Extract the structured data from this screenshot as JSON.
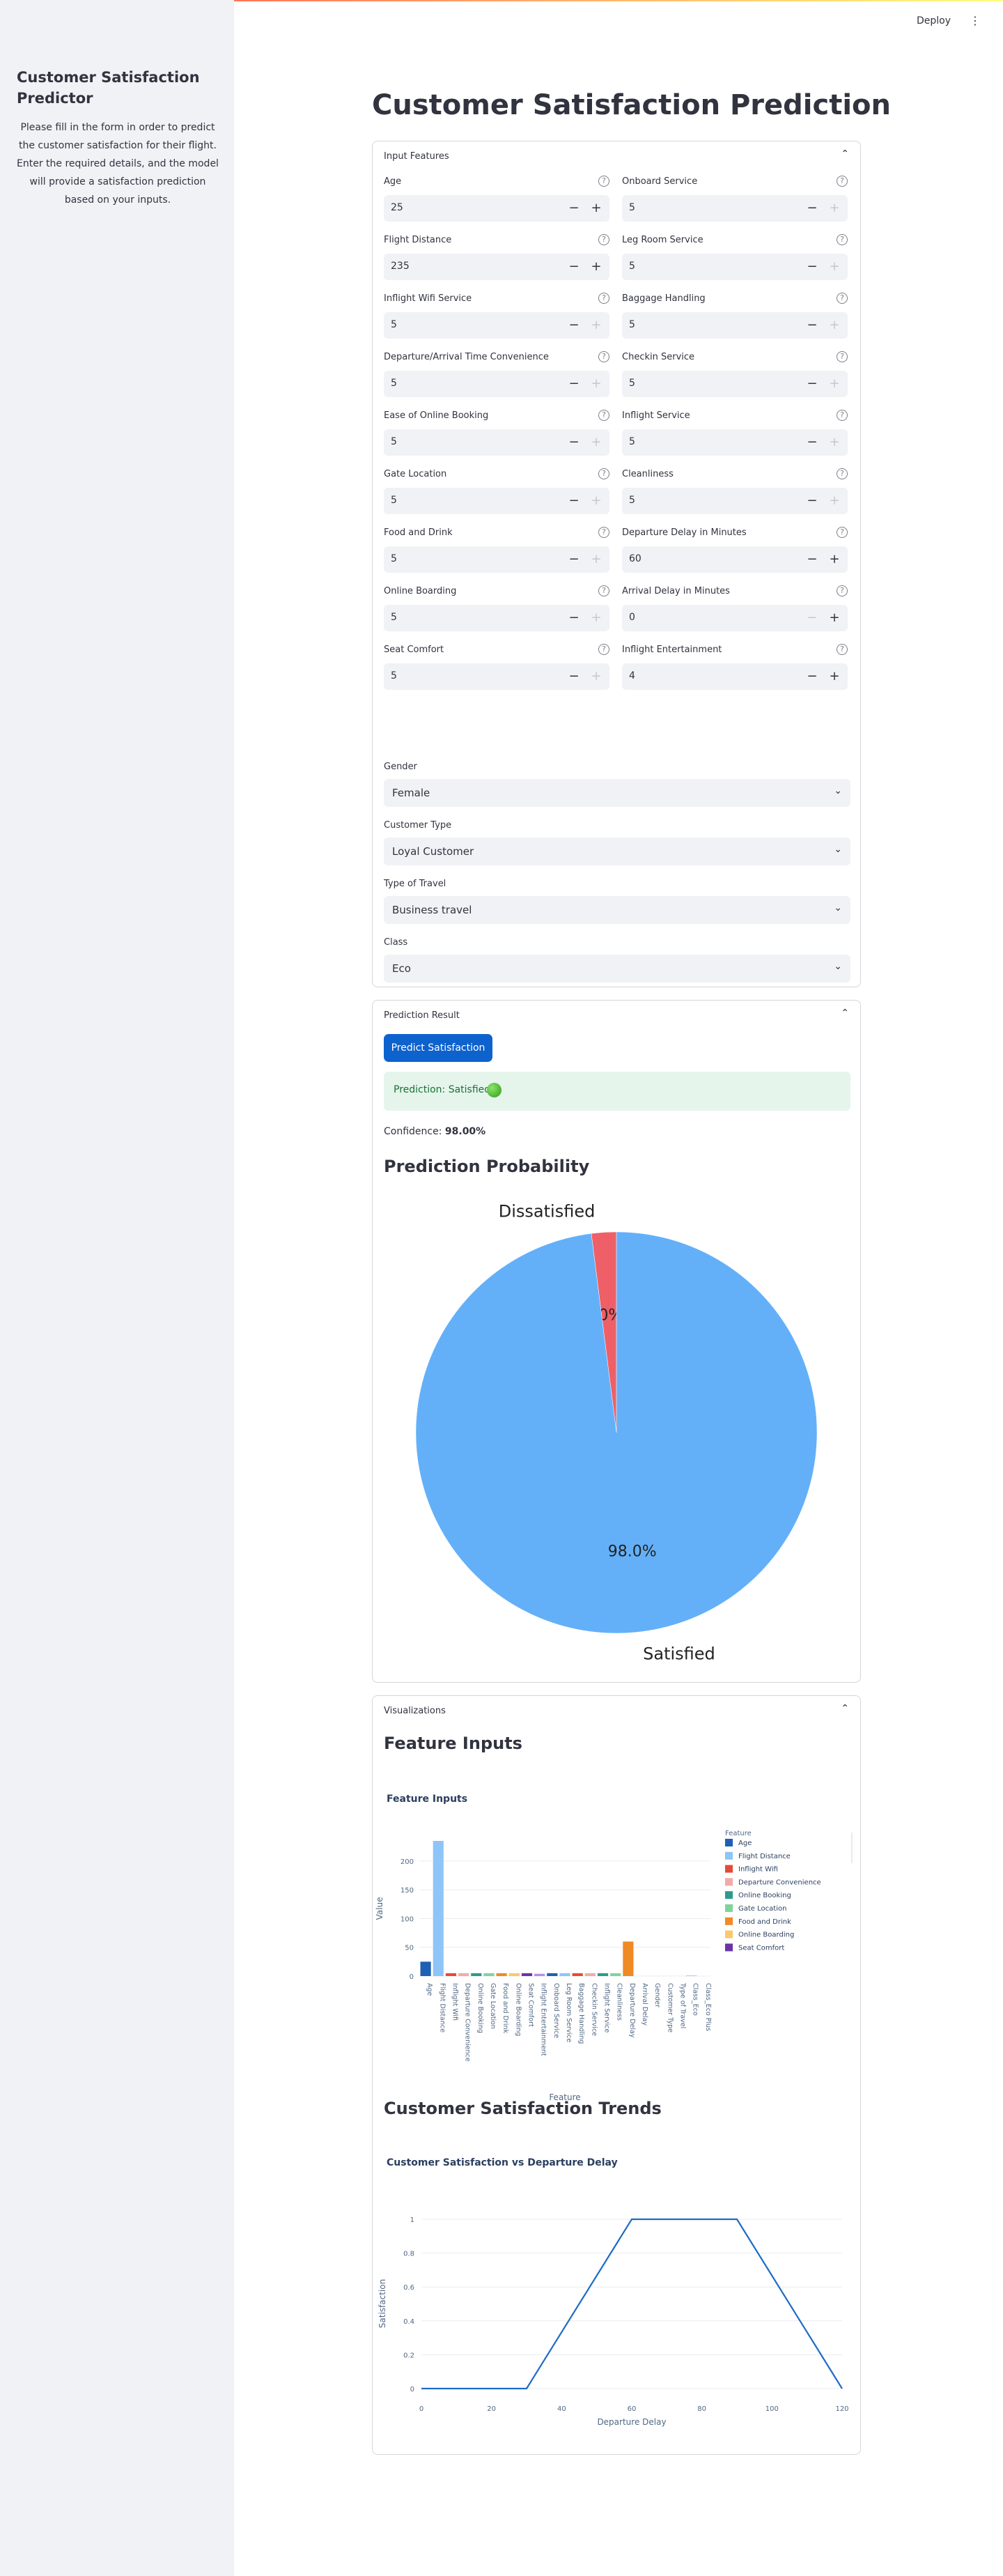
{
  "app": {
    "deploy_label": "Deploy",
    "menu_glyph": "⋮"
  },
  "sidebar": {
    "title": "Customer Satisfaction Predictor",
    "description": "Please fill in the form in order to predict the customer satisfaction for their flight. Enter the required details, and the model will provide a satisfaction prediction based on your inputs."
  },
  "page_title": "Customer Satisfaction Prediction",
  "input_features": {
    "header": "Input Features",
    "fields": [
      {
        "label": "Age",
        "value": "25",
        "minus_disabled": false,
        "plus_disabled": false
      },
      {
        "label": "Onboard Service",
        "value": "5",
        "minus_disabled": false,
        "plus_disabled": true
      },
      {
        "label": "Flight Distance",
        "value": "235",
        "minus_disabled": false,
        "plus_disabled": false
      },
      {
        "label": "Leg Room Service",
        "value": "5",
        "minus_disabled": false,
        "plus_disabled": true
      },
      {
        "label": "Inflight Wifi Service",
        "value": "5",
        "minus_disabled": false,
        "plus_disabled": true
      },
      {
        "label": "Baggage Handling",
        "value": "5",
        "minus_disabled": false,
        "plus_disabled": true
      },
      {
        "label": "Departure/Arrival Time Convenience",
        "value": "5",
        "minus_disabled": false,
        "plus_disabled": true
      },
      {
        "label": "Checkin Service",
        "value": "5",
        "minus_disabled": false,
        "plus_disabled": true
      },
      {
        "label": "Ease of Online Booking",
        "value": "5",
        "minus_disabled": false,
        "plus_disabled": true
      },
      {
        "label": "Inflight Service",
        "value": "5",
        "minus_disabled": false,
        "plus_disabled": true
      },
      {
        "label": "Gate Location",
        "value": "5",
        "minus_disabled": false,
        "plus_disabled": true
      },
      {
        "label": "Cleanliness",
        "value": "5",
        "minus_disabled": false,
        "plus_disabled": true
      },
      {
        "label": "Food and Drink",
        "value": "5",
        "minus_disabled": false,
        "plus_disabled": true
      },
      {
        "label": "Departure Delay in Minutes",
        "value": "60",
        "minus_disabled": false,
        "plus_disabled": false
      },
      {
        "label": "Online Boarding",
        "value": "5",
        "minus_disabled": false,
        "plus_disabled": true
      },
      {
        "label": "Arrival Delay in Minutes",
        "value": "0",
        "minus_disabled": true,
        "plus_disabled": false
      },
      {
        "label": "Seat Comfort",
        "value": "5",
        "minus_disabled": false,
        "plus_disabled": true
      },
      {
        "label": "Inflight Entertainment",
        "value": "4",
        "minus_disabled": false,
        "plus_disabled": false
      }
    ],
    "selects": [
      {
        "label": "Gender",
        "value": "Female"
      },
      {
        "label": "Customer Type",
        "value": "Loyal Customer"
      },
      {
        "label": "Type of Travel",
        "value": "Business travel"
      },
      {
        "label": "Class",
        "value": "Eco"
      }
    ],
    "help_glyph": "?",
    "minus_glyph": "−",
    "plus_glyph": "+",
    "chevron_up": "⌃",
    "chevron_down": "⌄"
  },
  "prediction": {
    "header": "Prediction Result",
    "button_label": "Predict Satisfaction",
    "result_text": "Prediction: Satisfied",
    "confidence_label": "Confidence: ",
    "confidence_value": "98.00%",
    "probability_title": "Prediction Probability"
  },
  "visualizations": {
    "header": "Visualizations",
    "feature_inputs_heading": "Feature Inputs",
    "trends_heading": "Customer Satisfaction Trends"
  },
  "chart_data": [
    {
      "type": "pie",
      "title": "",
      "labels": [
        "Dissatisfied",
        "Satisfied"
      ],
      "values": [
        2.0,
        98.0
      ],
      "value_labels": [
        "2.0%",
        "98.0%"
      ],
      "colors": [
        "#ef5f67",
        "#63b0f9"
      ]
    },
    {
      "type": "bar",
      "title": "Feature Inputs",
      "xlabel": "Feature",
      "ylabel": "Value",
      "ylim": [
        0,
        235
      ],
      "yticks": [
        0,
        50,
        100,
        150,
        200
      ],
      "categories": [
        "Age",
        "Flight Distance",
        "Inflight Wifi",
        "Departure Convenience",
        "Online Booking",
        "Gate Location",
        "Food and Drink",
        "Online Boarding",
        "Seat Comfort",
        "Inflight Entertainment",
        "Onboard Service",
        "Leg Room Service",
        "Baggage Handling",
        "Checkin Service",
        "Inflight Service",
        "Cleanliness",
        "Departure Delay",
        "Arrival Delay",
        "Gender",
        "Customer Type",
        "Type of Travel",
        "Class_Eco",
        "Class_Eco Plus"
      ],
      "values": [
        25,
        235,
        5,
        5,
        5,
        5,
        5,
        5,
        5,
        4,
        5,
        5,
        5,
        5,
        5,
        5,
        60,
        0,
        0,
        0,
        0,
        1,
        0
      ],
      "colors": [
        "#1f5fb4",
        "#8ec5f8",
        "#e24c37",
        "#f4a9a8",
        "#2e9a8c",
        "#7fd49b",
        "#f08a24",
        "#f9c96b",
        "#6a35a6",
        "#b88ee5",
        "#1f5fb4",
        "#8ec5f8",
        "#e24c37",
        "#f4a9a8",
        "#2e9a8c",
        "#7fd49b",
        "#f08a24",
        "#f9c96b",
        "#6a35a6",
        "#b88ee5",
        "#1f5fb4",
        "#8ec5f8",
        "#e24c37"
      ],
      "legend_title": "Feature",
      "legend_entries": [
        {
          "name": "Age",
          "color": "#1f5fb4"
        },
        {
          "name": "Flight Distance",
          "color": "#8ec5f8"
        },
        {
          "name": "Inflight Wifi",
          "color": "#e24c37"
        },
        {
          "name": "Departure Convenience",
          "color": "#f4a9a8"
        },
        {
          "name": "Online Booking",
          "color": "#2e9a8c"
        },
        {
          "name": "Gate Location",
          "color": "#7fd49b"
        },
        {
          "name": "Food and Drink",
          "color": "#f08a24"
        },
        {
          "name": "Online Boarding",
          "color": "#f9c96b"
        },
        {
          "name": "Seat Comfort",
          "color": "#6a35a6"
        }
      ],
      "legend_placement": "right"
    },
    {
      "type": "line",
      "title": "Customer Satisfaction vs Departure Delay",
      "xlabel": "Departure Delay",
      "ylabel": "Satisfaction",
      "x": [
        0,
        30,
        60,
        90,
        120
      ],
      "y": [
        0,
        0,
        1,
        1,
        0
      ],
      "xlim": [
        0,
        120
      ],
      "ylim": [
        0,
        1
      ],
      "xticks": [
        0,
        20,
        40,
        60,
        80,
        100,
        120
      ],
      "yticks": [
        0,
        0.2,
        0.4,
        0.6,
        0.8,
        1
      ],
      "color": "#1d6bc6",
      "grid": true
    }
  ]
}
